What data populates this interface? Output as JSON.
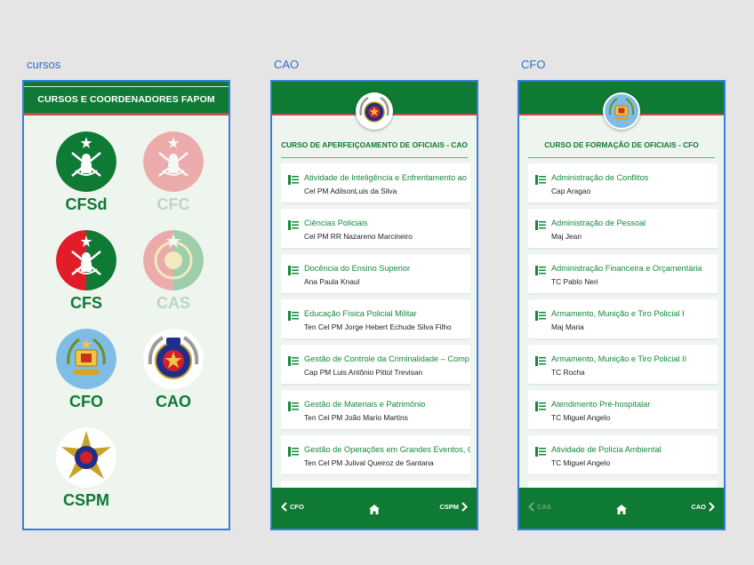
{
  "artboards": {
    "cursos": {
      "label": "cursos",
      "header_title": "CURSOS E COORDENADORES FAPOM",
      "courses": [
        {
          "code": "CFSd",
          "active": true
        },
        {
          "code": "CFC",
          "active": false
        },
        {
          "code": "CFS",
          "active": true
        },
        {
          "code": "CAS",
          "active": false
        },
        {
          "code": "CFO",
          "active": true
        },
        {
          "code": "CAO",
          "active": true
        },
        {
          "code": "CSPM",
          "active": true
        }
      ]
    },
    "cao": {
      "label": "CAO",
      "title": "CURSO DE APERFEIÇOAMENTO DE OFICIAIS - CAO",
      "items": [
        {
          "discipline": "Atividade de Inteligência e Enfrentamento ao",
          "teacher": "Cel PM AdilsonLuis da Silva"
        },
        {
          "discipline": "Ciências Policiais",
          "teacher": "Cel PM RR Nazareno Marcineiro"
        },
        {
          "discipline": "Docência do Ensino Superior",
          "teacher": "Ana Paula Knaul"
        },
        {
          "discipline": "Educação Física Policial Militar",
          "teacher": "Ten Cel PM Jorge Hebert Echude Silva Filho"
        },
        {
          "discipline": "Gestão de Controle da Criminalidade – Comp",
          "teacher": "Cap PM Luis Antônio Pittol Trevisan"
        },
        {
          "discipline": "Gestão de Materiais e Patrimônio",
          "teacher": "Ten Cel PM João Mario Martins"
        },
        {
          "discipline": "Gestão de Operações em Grandes Eventos, C",
          "teacher": "Ten Cel PM Julival Queiroz de Santana"
        },
        {
          "discipline": "",
          "teacher": ""
        }
      ],
      "footer": {
        "prev": "CFO",
        "next": "CSPM",
        "prev_enabled": true
      }
    },
    "cfo": {
      "label": "CFO",
      "title": "CURSO DE FORMAÇÃO DE OFICIAIS - CFO",
      "items": [
        {
          "discipline": "Administração de Conflitos",
          "teacher": "Cap Aragao"
        },
        {
          "discipline": "Administração de Pessoal",
          "teacher": "Maj Jean"
        },
        {
          "discipline": "Administração Financeira e Orçamentária",
          "teacher": "TC Pablo Neri"
        },
        {
          "discipline": "Armamento, Munição e Tiro Policial I",
          "teacher": "Maj Maria"
        },
        {
          "discipline": "Armamento, Munição e Tiro Policial II",
          "teacher": "TC Rocha"
        },
        {
          "discipline": "Atendimento Pré-hospitalar",
          "teacher": "TC Miguel Angelo"
        },
        {
          "discipline": "Atividade de Polícia Ambiental",
          "teacher": "TC Miguel Angelo"
        },
        {
          "discipline": "",
          "teacher": ""
        }
      ],
      "footer": {
        "prev": "CAS",
        "next": "CAO",
        "prev_enabled": false
      }
    }
  },
  "colors": {
    "primary": "#0e7a33",
    "accent_red": "#c0504d",
    "link_green": "#14893c",
    "artboard_border": "#3a7de0"
  },
  "icons": [
    "document-icon",
    "home-icon",
    "chevron-left-icon",
    "chevron-right-icon",
    "sword-crest-icon",
    "cfo-crest-icon",
    "pmsc-emblem-icon",
    "cspm-emblem-icon"
  ]
}
